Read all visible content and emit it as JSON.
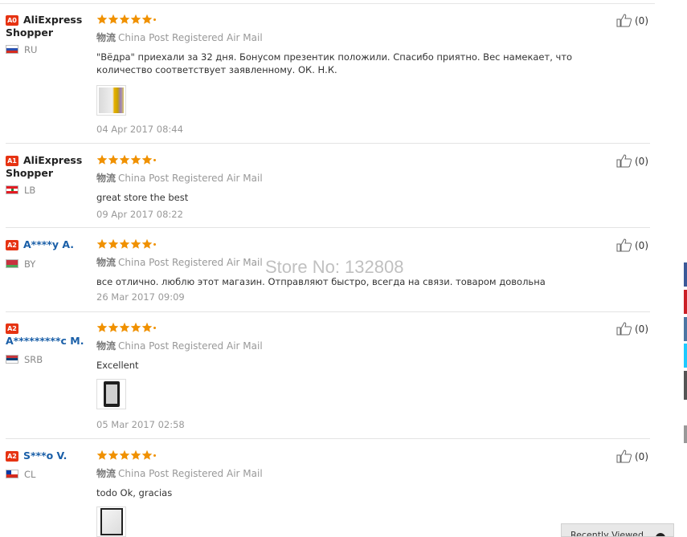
{
  "feedback": [
    {
      "badge": "A0",
      "buyer_name": "AliExpress Shopper",
      "buyer_style": "black",
      "country": "RU",
      "stars": 5,
      "logistics_label": "物流",
      "logistics": "China Post Registered Air Mail",
      "comment": "\"Вёдра\" приехали за 32 дня. Бонусом презентик положили. Спасибо приятно. Вес намекает, что количество соответствует заявленному. ОК. Н.К.",
      "has_photo": true,
      "date": "04 Apr 2017 08:44",
      "helpful_count": "(0)"
    },
    {
      "badge": "A1",
      "buyer_name": "AliExpress Shopper",
      "buyer_style": "black",
      "country": "LB",
      "stars": 5,
      "logistics_label": "物流",
      "logistics": "China Post Registered Air Mail",
      "comment": "great store the best",
      "has_photo": false,
      "date": "09 Apr 2017 08:22",
      "helpful_count": "(0)"
    },
    {
      "badge": "A2",
      "buyer_name": "A****y A.",
      "buyer_style": "blue",
      "country": "BY",
      "stars": 5,
      "logistics_label": "物流",
      "logistics": "China Post Registered Air Mail",
      "comment": "все отлично. люблю этот магазин. Отправляют быстро, всегда на связи. товаром довольна",
      "has_photo": false,
      "date": "26 Mar 2017 09:09",
      "helpful_count": "(0)"
    },
    {
      "badge": "A2",
      "buyer_name": "A*********c M.",
      "buyer_style": "blue",
      "country": "SRB",
      "stars": 5,
      "logistics_label": "物流",
      "logistics": "China Post Registered Air Mail",
      "comment": "Excellent",
      "has_photo": true,
      "date": "05 Mar 2017 02:58",
      "helpful_count": "(0)"
    },
    {
      "badge": "A2",
      "buyer_name": "S***o V.",
      "buyer_style": "blue",
      "country": "CL",
      "stars": 5,
      "logistics_label": "物流",
      "logistics": "China Post Registered Air Mail",
      "comment": "todo Ok, gracias",
      "has_photo": true,
      "date": "",
      "helpful_count": "(0)"
    }
  ],
  "watermark": "Store No: 132808",
  "recent_panel_label": "Recently Viewed",
  "colors": {
    "star": "#f09100",
    "badge": "#e63312",
    "buyer_link": "#1a5fa8"
  }
}
